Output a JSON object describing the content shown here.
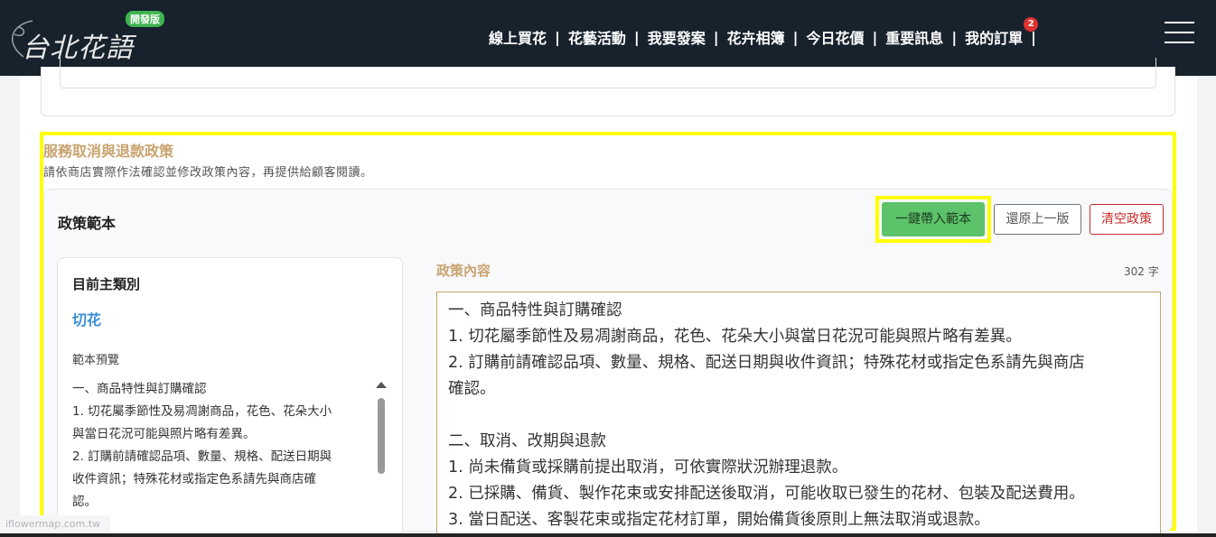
{
  "header": {
    "logo_text": "台北花語",
    "logo_badge": "開發版",
    "nav": [
      {
        "label": "線上買花"
      },
      {
        "label": "花藝活動"
      },
      {
        "label": "我要發案"
      },
      {
        "label": "花卉相簿"
      },
      {
        "label": "今日花價"
      },
      {
        "label": "重要訊息"
      },
      {
        "label": "我的訂單",
        "badge": "2"
      }
    ],
    "menu_icon": "hamburger-icon"
  },
  "section": {
    "title": "服務取消與退款政策",
    "description": "請依商店實際作法確認並修改政策內容，再提供給顧客閱讀。",
    "template_label": "政策範本",
    "buttons": {
      "apply": "一鍵帶入範本",
      "restore": "還原上一版",
      "clear": "清空政策"
    },
    "left": {
      "category_label": "目前主類別",
      "category_value": "切花",
      "preview_label": "範本預覽",
      "preview_lines": [
        "一、商品特性與訂購確認",
        "1. 切花屬季節性及易凋謝商品，花色、花朵大小",
        "與當日花況可能與照片略有差異。",
        "2. 訂購前請確認品項、數量、規格、配送日期與",
        "收件資訊；特殊花材或指定色系請先與商店確",
        "認。"
      ]
    },
    "right": {
      "content_label": "政策內容",
      "char_count": "302 字",
      "content_lines": [
        "一、商品特性與訂購確認",
        "1. 切花屬季節性及易凋謝商品，花色、花朵大小與當日花況可能與照片略有差異。",
        "2. 訂購前請確認品項、數量、規格、配送日期與收件資訊；特殊花材或指定色系請先與商店",
        "確認。",
        "",
        "二、取消、改期與退款",
        "1. 尚未備貨或採購前提出取消，可依實際狀況辦理退款。",
        "2. 已採購、備貨、製作花束或安排配送後取消，可能收取已發生的花材、包裝及配送費用。",
        "3. 當日配送、客製花束或指定花材訂單，開始備貨後原則上無法取消或退款。"
      ]
    }
  },
  "watermark": "iflowermap.com.tw",
  "colors": {
    "header_bg": "#17222d",
    "accent": "#c9a36f",
    "highlight": "#ffff00",
    "apply_button": "#5cc36a",
    "clear_button": "#c92a2a",
    "category": "#3a8fd6"
  }
}
